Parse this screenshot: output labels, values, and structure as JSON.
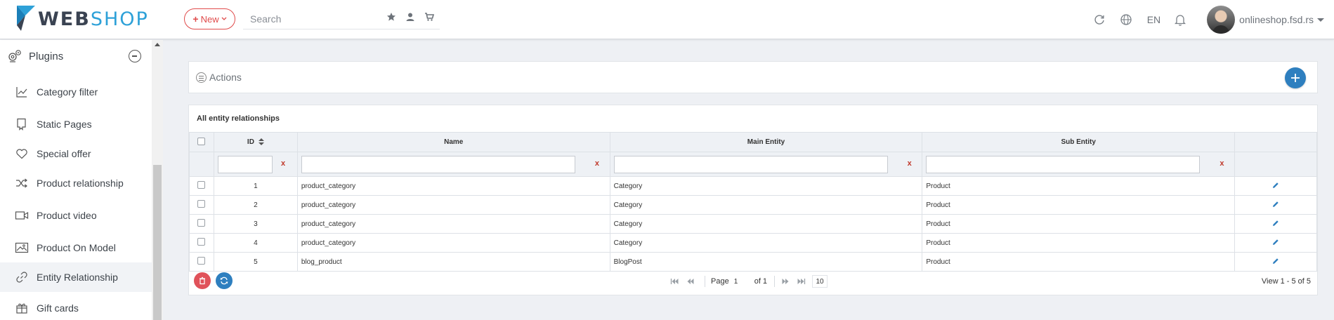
{
  "header": {
    "logo_web": "WEB",
    "logo_shop": "SHOP",
    "new_label": "New",
    "search_placeholder": "Search",
    "lang": "EN",
    "site_name": "onlineshop.fsd.rs",
    "accent": "#2ea1d8",
    "new_color": "#e04b4b"
  },
  "sidebar": {
    "section": "Plugins",
    "items": [
      {
        "label": "Category filter",
        "icon": "chart-icon"
      },
      {
        "label": "Static Pages",
        "icon": "bookmark-icon"
      },
      {
        "label": "Special offer",
        "icon": "heart-icon"
      },
      {
        "label": "Product relationship",
        "icon": "shuffle-icon"
      },
      {
        "label": "Product video",
        "icon": "video-icon"
      },
      {
        "label": "Product On Model",
        "icon": "image-icon"
      },
      {
        "label": "Entity Relationship",
        "icon": "link-icon",
        "active": true
      },
      {
        "label": "Gift cards",
        "icon": "gift-icon"
      }
    ]
  },
  "actions": {
    "label": "Actions"
  },
  "grid": {
    "title": "All entity relationships",
    "columns": [
      "ID",
      "Name",
      "Main Entity",
      "Sub Entity"
    ],
    "clear_label": "x",
    "rows": [
      {
        "id": "1",
        "name": "product_category",
        "main": "Category",
        "sub": "Product"
      },
      {
        "id": "2",
        "name": "product_category",
        "main": "Category",
        "sub": "Product"
      },
      {
        "id": "3",
        "name": "product_category",
        "main": "Category",
        "sub": "Product"
      },
      {
        "id": "4",
        "name": "product_category",
        "main": "Category",
        "sub": "Product"
      },
      {
        "id": "5",
        "name": "blog_product",
        "main": "BlogPost",
        "sub": "Product"
      }
    ]
  },
  "pager": {
    "page_label": "Page",
    "page_value": "1",
    "of_label": "of 1",
    "page_size": "10",
    "view_info": "View 1 - 5 of 5"
  }
}
